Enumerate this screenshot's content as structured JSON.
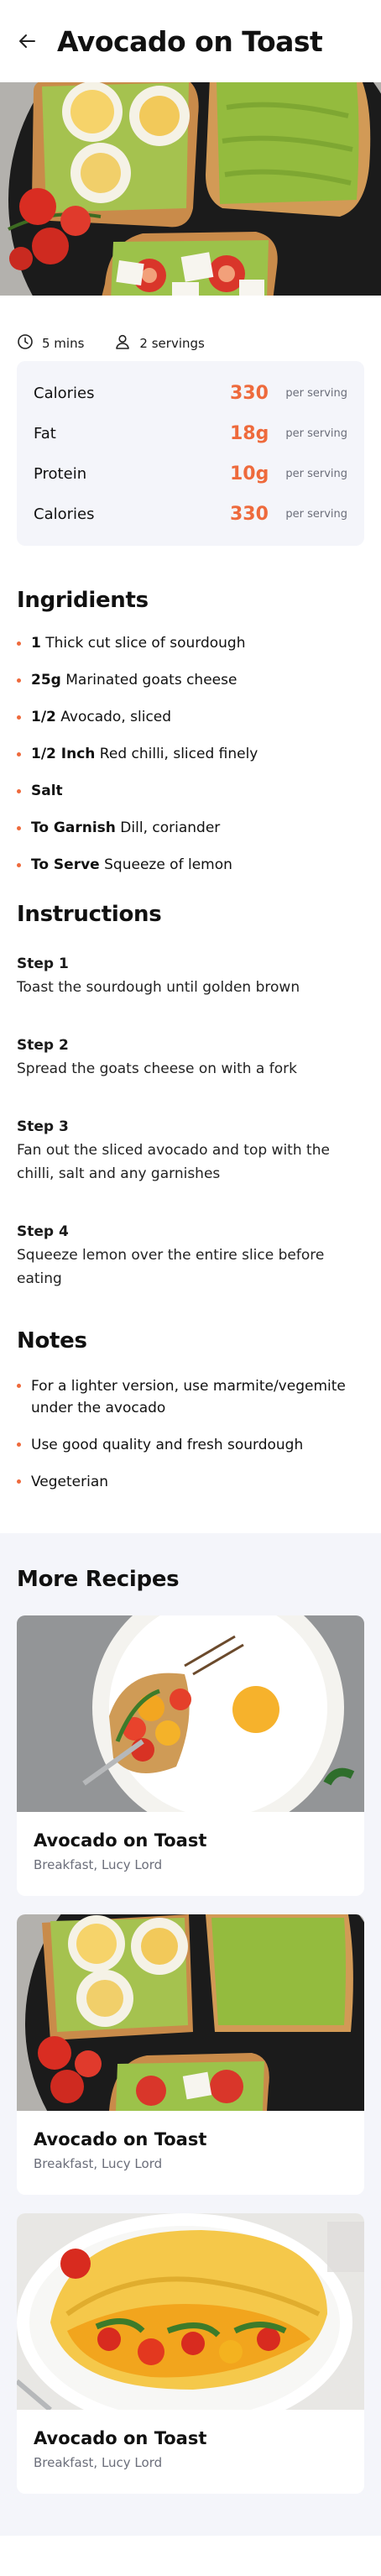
{
  "header": {
    "title": "Avocado on Toast",
    "back_icon": "arrow-left-icon"
  },
  "meta": {
    "time": "5 mins",
    "servings": "2 servings"
  },
  "nutrition": [
    {
      "label": "Calories",
      "value": "330",
      "unit": "per serving"
    },
    {
      "label": "Fat",
      "value": "18g",
      "unit": "per serving"
    },
    {
      "label": "Protein",
      "value": "10g",
      "unit": "per serving"
    },
    {
      "label": "Calories",
      "value": "330",
      "unit": "per serving"
    }
  ],
  "ingredients": {
    "title": "Ingridients",
    "items": [
      {
        "bold": "1",
        "text": " Thick cut slice of sourdough"
      },
      {
        "bold": "25g",
        "text": " Marinated goats cheese"
      },
      {
        "bold": "1/2",
        "text": " Avocado, sliced"
      },
      {
        "bold": "1/2 Inch",
        "text": " Red chilli, sliced finely"
      },
      {
        "bold": "Salt",
        "text": ""
      },
      {
        "bold": "To Garnish",
        "text": " Dill, coriander"
      },
      {
        "bold": "To Serve",
        "text": " Squeeze of lemon"
      }
    ]
  },
  "instructions": {
    "title": "Instructions",
    "steps": [
      {
        "title": "Step 1",
        "text": "Toast the sourdough until golden brown"
      },
      {
        "title": "Step 2",
        "text": "Spread the goats cheese on with a fork"
      },
      {
        "title": "Step 3",
        "text": "Fan out the sliced avocado and top with the chilli, salt and any garnishes"
      },
      {
        "title": "Step 4",
        "text": "Squeeze lemon over the entire slice before eating"
      }
    ]
  },
  "notes": {
    "title": "Notes",
    "items": [
      "For a lighter version, use marmite/vegemite under the avocado",
      "Use good quality and fresh sourdough",
      "Vegeterian"
    ]
  },
  "more_recipes": {
    "title": "More Recipes",
    "cards": [
      {
        "title": "Avocado on Toast",
        "subtitle": "Breakfast, Lucy Lord"
      },
      {
        "title": "Avocado on Toast",
        "subtitle": "Breakfast, Lucy Lord"
      },
      {
        "title": "Avocado on Toast",
        "subtitle": "Breakfast, Lucy Lord"
      }
    ]
  },
  "colors": {
    "accent": "#ee6a3c",
    "panel": "#f4f5fa",
    "text": "#111111",
    "muted": "#6b6e7a"
  }
}
